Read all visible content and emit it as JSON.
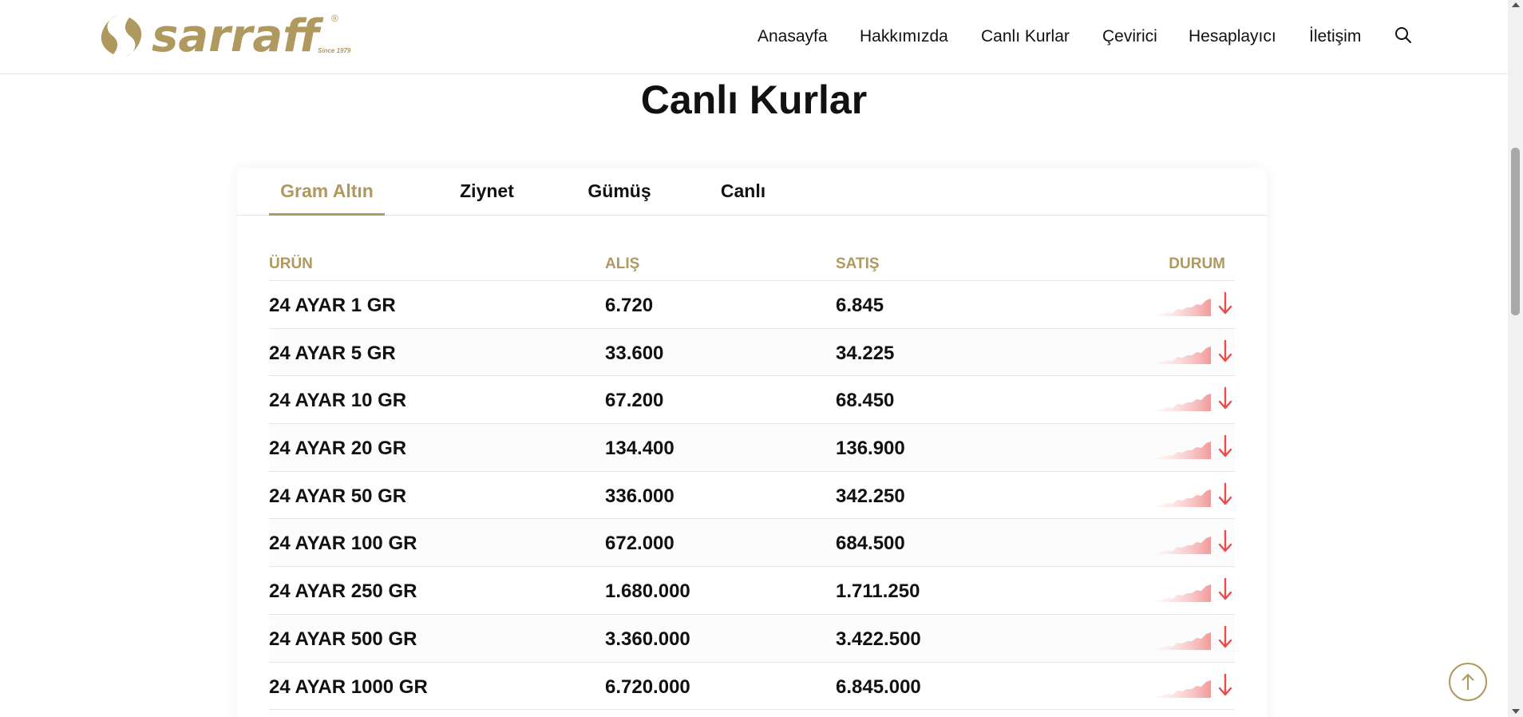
{
  "brand": {
    "name": "sarraff",
    "registered": "®",
    "since": "Since 1979",
    "color": "#b0995f"
  },
  "nav": {
    "items": [
      "Anasayfa",
      "Hakkımızda",
      "Canlı Kurlar",
      "Çevirici",
      "Hesaplayıcı",
      "İletişim"
    ],
    "search_icon": "search-icon"
  },
  "page": {
    "title": "Canlı Kurlar"
  },
  "tabs": [
    {
      "label": "Gram Altın",
      "active": true
    },
    {
      "label": "Ziynet",
      "active": false
    },
    {
      "label": "Gümüş",
      "active": false
    },
    {
      "label": "Canlı",
      "active": false
    }
  ],
  "table": {
    "headers": {
      "product": "ÜRÜN",
      "buy": "ALIŞ",
      "sell": "SATIŞ",
      "status": "DURUM"
    },
    "rows": [
      {
        "product": "24 AYAR 1 GR",
        "buy": "6.720",
        "sell": "6.845",
        "trend": "down"
      },
      {
        "product": "24 AYAR 5 GR",
        "buy": "33.600",
        "sell": "34.225",
        "trend": "down"
      },
      {
        "product": "24 AYAR 10 GR",
        "buy": "67.200",
        "sell": "68.450",
        "trend": "down"
      },
      {
        "product": "24 AYAR 20 GR",
        "buy": "134.400",
        "sell": "136.900",
        "trend": "down"
      },
      {
        "product": "24 AYAR 50 GR",
        "buy": "336.000",
        "sell": "342.250",
        "trend": "down"
      },
      {
        "product": "24 AYAR 100 GR",
        "buy": "672.000",
        "sell": "684.500",
        "trend": "down"
      },
      {
        "product": "24 AYAR 250 GR",
        "buy": "1.680.000",
        "sell": "1.711.250",
        "trend": "down"
      },
      {
        "product": "24 AYAR 500 GR",
        "buy": "3.360.000",
        "sell": "3.422.500",
        "trend": "down"
      },
      {
        "product": "24 AYAR 1000 GR",
        "buy": "6.720.000",
        "sell": "6.845.000",
        "trend": "down"
      }
    ]
  },
  "colors": {
    "accent": "#b0995f",
    "down": "#e84c4c",
    "spark_fill": "#f7b5b5"
  }
}
